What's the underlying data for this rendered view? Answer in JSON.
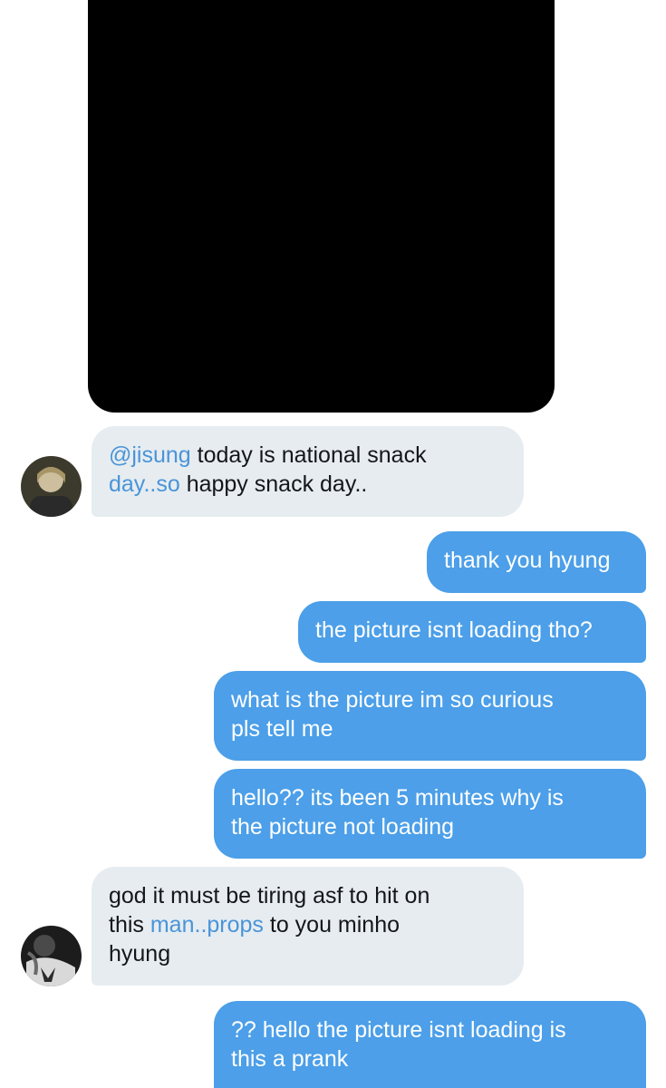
{
  "conversation": {
    "media_placeholder": "",
    "messages": [
      {
        "sender": "incoming",
        "mention": "@jisung",
        "text_a": " today is national snack",
        "link": "day..so",
        "text_b": " happy snack day.."
      },
      {
        "sender": "outgoing",
        "text": "thank you hyung"
      },
      {
        "sender": "outgoing",
        "text": "the picture isnt loading tho?"
      },
      {
        "sender": "outgoing",
        "line1": "what is the picture im so curious",
        "line2": "pls tell me"
      },
      {
        "sender": "outgoing",
        "line1": "hello?? its been 5 minutes why is",
        "line2": "the picture not loading"
      },
      {
        "sender": "incoming",
        "line1": "god it must be tiring asf to hit on",
        "line2_a": "this ",
        "link": "man..props",
        "line2_b": " to you minho",
        "line3": "hyung"
      },
      {
        "sender": "outgoing",
        "line1": "?? hello the picture isnt loading is",
        "line2": "this a prank"
      }
    ]
  },
  "colors": {
    "incoming_bubble": "#e6ecf0",
    "outgoing_bubble": "#4c9fe8",
    "link": "#4a94d8",
    "media": "#000000"
  },
  "icons": [
    "avatar-1",
    "avatar-2"
  ]
}
